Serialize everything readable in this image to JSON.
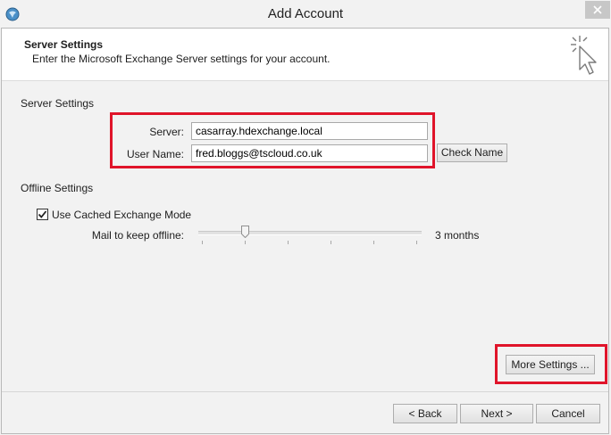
{
  "window": {
    "title": "Add Account"
  },
  "header": {
    "title": "Server Settings",
    "subtitle": "Enter the Microsoft Exchange Server settings for your account."
  },
  "server_settings": {
    "section_label": "Server Settings",
    "server_label": "Server:",
    "server_value": "casarray.hdexchange.local",
    "username_label": "User Name:",
    "username_value": "fred.bloggs@tscloud.co.uk",
    "check_name_label": "Check Name"
  },
  "offline_settings": {
    "section_label": "Offline Settings",
    "cached_mode_label": "Use Cached Exchange Mode",
    "cached_mode_checked": true,
    "mail_keep_label": "Mail to keep offline:",
    "mail_keep_value": "3 months"
  },
  "buttons": {
    "more_settings": "More Settings ...",
    "back": "< Back",
    "next": "Next >",
    "cancel": "Cancel"
  },
  "colors": {
    "highlight": "#e0142a",
    "background": "#f2f2f2"
  }
}
